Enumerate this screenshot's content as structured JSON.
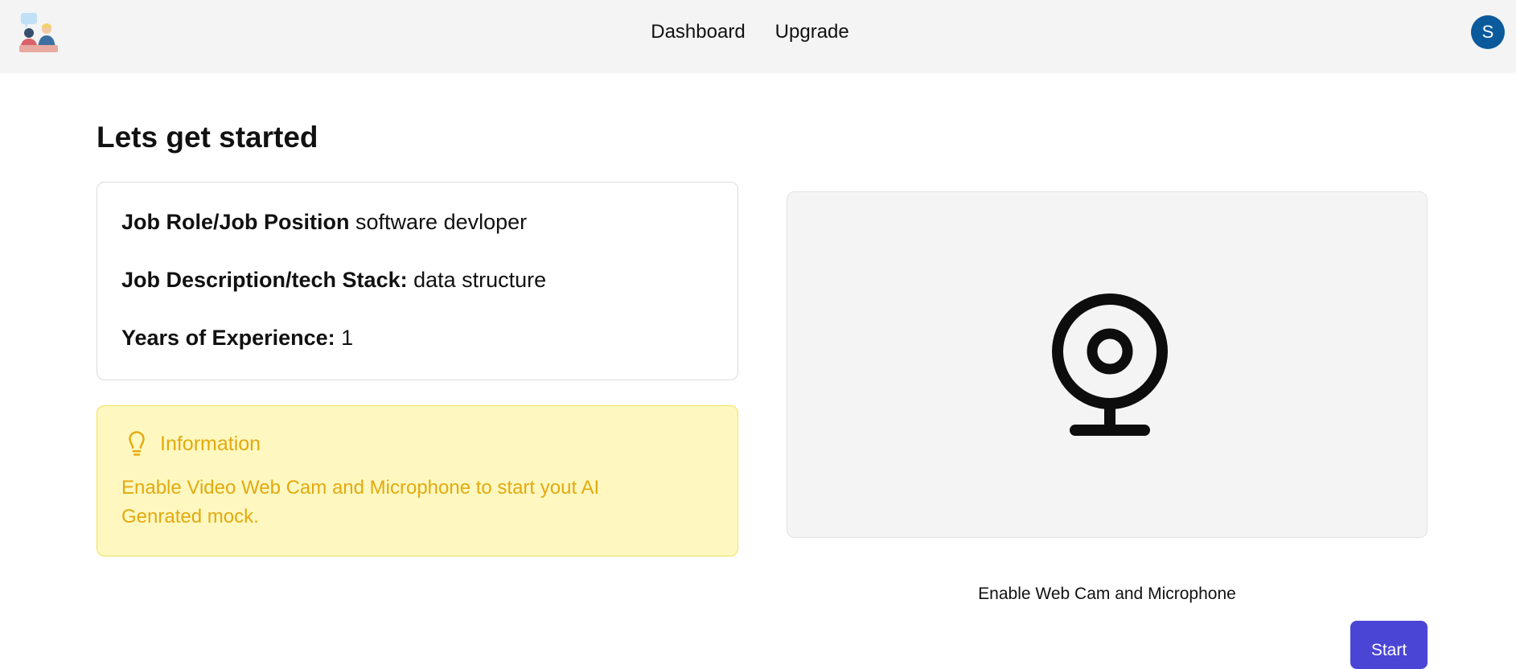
{
  "header": {
    "nav": [
      "Dashboard",
      "Upgrade"
    ],
    "avatar_initial": "S",
    "avatar_color": "#0a5a9c"
  },
  "main": {
    "title": "Lets get started",
    "details": {
      "role_label": "Job Role/Job Position",
      "role_value": "software devloper",
      "desc_label": "Job Description/tech Stack:",
      "desc_value": "data structure",
      "exp_label": "Years of Experience:",
      "exp_value": "1"
    },
    "info": {
      "icon": "lightbulb-icon",
      "heading": "Information",
      "text": "Enable Video Web Cam and Microphone to start yout AI Genrated mock.",
      "color": "#e3a90f",
      "background": "#fef8c0"
    },
    "webcam": {
      "icon": "webcam-icon",
      "enable_label": "Enable Web Cam and Microphone"
    },
    "start_label": "Start",
    "accent_color": "#4b45d6"
  }
}
